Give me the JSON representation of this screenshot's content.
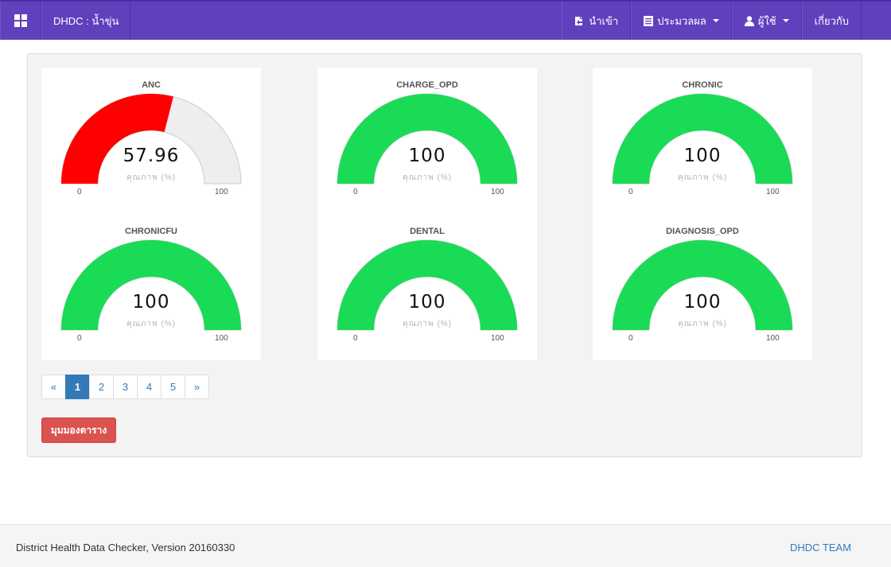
{
  "navbar": {
    "brand": "DHDC : น้ำขุ่น",
    "items": [
      {
        "label": "นำเข้า",
        "icon": "import-icon"
      },
      {
        "label": "ประมวลผล",
        "icon": "list-icon",
        "dropdown": true
      },
      {
        "label": "ผู้ใช้",
        "icon": "user-icon",
        "dropdown": true
      },
      {
        "label": "เกี่ยวกับ"
      }
    ]
  },
  "gauges": [
    {
      "title": "ANC",
      "value": "57.96",
      "percent": 57.96,
      "unit": "คุณภาพ (%)",
      "min": "0",
      "max": "100",
      "color": "#ff0000"
    },
    {
      "title": "CHARGE_OPD",
      "value": "100",
      "percent": 100,
      "unit": "คุณภาพ (%)",
      "min": "0",
      "max": "100",
      "color": "#1adb56"
    },
    {
      "title": "CHRONIC",
      "value": "100",
      "percent": 100,
      "unit": "คุณภาพ (%)",
      "min": "0",
      "max": "100",
      "color": "#1adb56"
    },
    {
      "title": "CHRONICFU",
      "value": "100",
      "percent": 100,
      "unit": "คุณภาพ (%)",
      "min": "0",
      "max": "100",
      "color": "#1adb56"
    },
    {
      "title": "DENTAL",
      "value": "100",
      "percent": 100,
      "unit": "คุณภาพ (%)",
      "min": "0",
      "max": "100",
      "color": "#1adb56"
    },
    {
      "title": "DIAGNOSIS_OPD",
      "value": "100",
      "percent": 100,
      "unit": "คุณภาพ (%)",
      "min": "0",
      "max": "100",
      "color": "#1adb56"
    }
  ],
  "pagination": {
    "prev": "«",
    "pages": [
      "1",
      "2",
      "3",
      "4",
      "5"
    ],
    "active": "1",
    "next": "»"
  },
  "table_view_button": "มุมมองตาราง",
  "footer": {
    "left": "District Health Data Checker, Version 20160330",
    "right": "DHDC TEAM"
  },
  "colors": {
    "navbar": "#6140be",
    "gauge_track": "#eeeeee",
    "danger": "#d9534f",
    "link": "#337ab7"
  }
}
